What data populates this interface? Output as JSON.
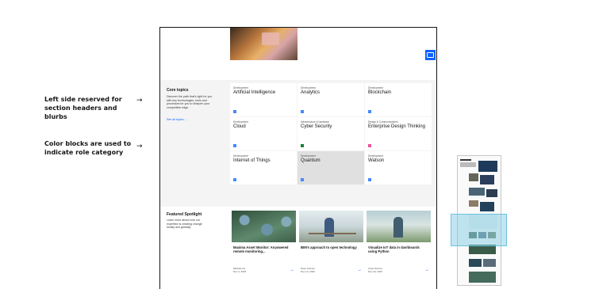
{
  "annotations": [
    {
      "text": "Left side reserved for section headers and blurbs",
      "arrow": "→"
    },
    {
      "text": "Color blocks are used to indicate role category",
      "arrow": "→"
    }
  ],
  "colors": {
    "development": "#4589ff",
    "infrastructure": "#198038",
    "design": "#ee5396",
    "link": "#0f62fe",
    "band": "#f4f4f4"
  },
  "core_topics": {
    "title": "Core topics",
    "blurb": "Discover the path that's right for you with key technologies, tools and processes for you to sharpen your competitive edge.",
    "link": "See all topics →",
    "tiles": [
      {
        "category": "Development",
        "name": "Artificial Intelligence",
        "color": "#4589ff"
      },
      {
        "category": "Development",
        "name": "Analytics",
        "color": "#4589ff"
      },
      {
        "category": "Development",
        "name": "Blockchain",
        "color": "#4589ff"
      },
      {
        "category": "Development",
        "name": "Cloud",
        "color": "#4589ff"
      },
      {
        "category": "Infrastructure & hardware",
        "name": "Cyber Security",
        "color": "#198038"
      },
      {
        "category": "Design & Communications",
        "name": "Enterprise Design Thinking",
        "color": "#ee5396"
      },
      {
        "category": "Development",
        "name": "Internet of Things",
        "color": "#4589ff"
      },
      {
        "category": "Development",
        "name": "Quantum",
        "color": "#4589ff"
      },
      {
        "category": "Development",
        "name": "Watson",
        "color": "#4589ff"
      }
    ]
  },
  "featured": {
    "title": "Featured Spotlight",
    "blurb": "Learn more about how our expertise is creating change locally and globally.",
    "cards": [
      {
        "title": "Maxima Asset Monitor: AI-powered remote monitoring...",
        "author": "Michael Liu",
        "date": "Nov 4, 2019",
        "arrow": "→"
      },
      {
        "title": "IBM's approach to open technology",
        "author": "Peter Garnes",
        "date": "Nov 12, 2019",
        "arrow": "→"
      },
      {
        "title": "Visualize IoT data in dashboards using Python",
        "author": "Anya Vesova",
        "date": "Dec 16, 2019",
        "arrow": "→"
      }
    ]
  }
}
